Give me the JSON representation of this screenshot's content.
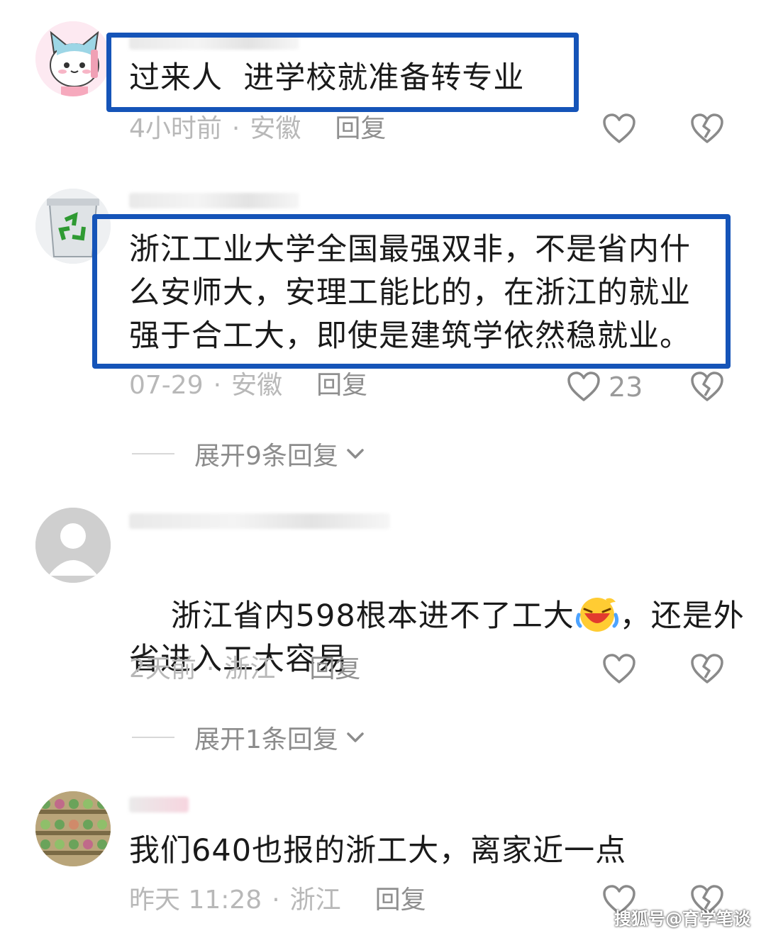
{
  "comments": [
    {
      "text": "过来人  进学校就准备转专业",
      "time": "4小时前",
      "location": "安徽",
      "reply_label": "回复",
      "likes": ""
    },
    {
      "text": "浙江工业大学全国最强双非，不是省内什\n么安师大，安理工能比的，在浙江的就业\n强于合工大，即使是建筑学依然稳就业。",
      "time": "07-29",
      "location": "安徽",
      "reply_label": "回复",
      "likes": "23",
      "expand_label": "展开9条回复"
    },
    {
      "text_before_emoji": "浙江省内598根本进不了工大",
      "text_after_emoji": "，还是外\n省进入工大容易",
      "time": "2天前",
      "location": "浙江",
      "reply_label": "回复",
      "likes": "",
      "expand_label": "展开1条回复"
    },
    {
      "text": "我们640也报的浙工大，离家近一点",
      "time": "昨天 11:28",
      "location": "浙江",
      "reply_label": "回复",
      "likes": ""
    }
  ],
  "separator": "·",
  "watermark": "搜狐号@育学笔谈",
  "icons": {
    "like": "heart-outline-icon",
    "dislike": "broken-heart-icon",
    "expand": "chevron-down-icon",
    "emoji": "laughing-crying-emoji"
  },
  "colors": {
    "highlight_box": "#1554b8",
    "meta_text": "#b8b8b8",
    "reply_text": "#8f8f8f",
    "icon_stroke": "#8a8a8a"
  }
}
